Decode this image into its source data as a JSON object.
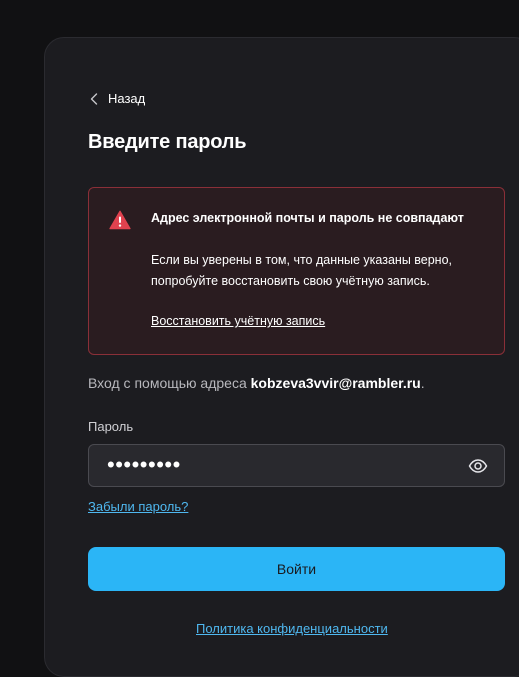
{
  "back": {
    "label": "Назад"
  },
  "page": {
    "title": "Введите пароль"
  },
  "alert": {
    "title": "Адрес электронной почты и пароль не совпадают",
    "body": "Если вы уверены в том, что данные указаны верно, попробуйте восстановить свою учётную запись.",
    "link": "Восстановить учётную запись",
    "color": "#e0424f"
  },
  "login": {
    "prefix": "Вход с помощью адреса ",
    "email": "kobzeva3vvir@rambler.ru",
    "suffix": "."
  },
  "password": {
    "label": "Пароль",
    "masked_value": "•••••••••",
    "toggle_icon": "eye-icon"
  },
  "forgot_link": "Забыли пароль?",
  "submit": {
    "label": "Войти",
    "color": "#2bb5f6"
  },
  "privacy_link": "Политика конфиденциальности"
}
